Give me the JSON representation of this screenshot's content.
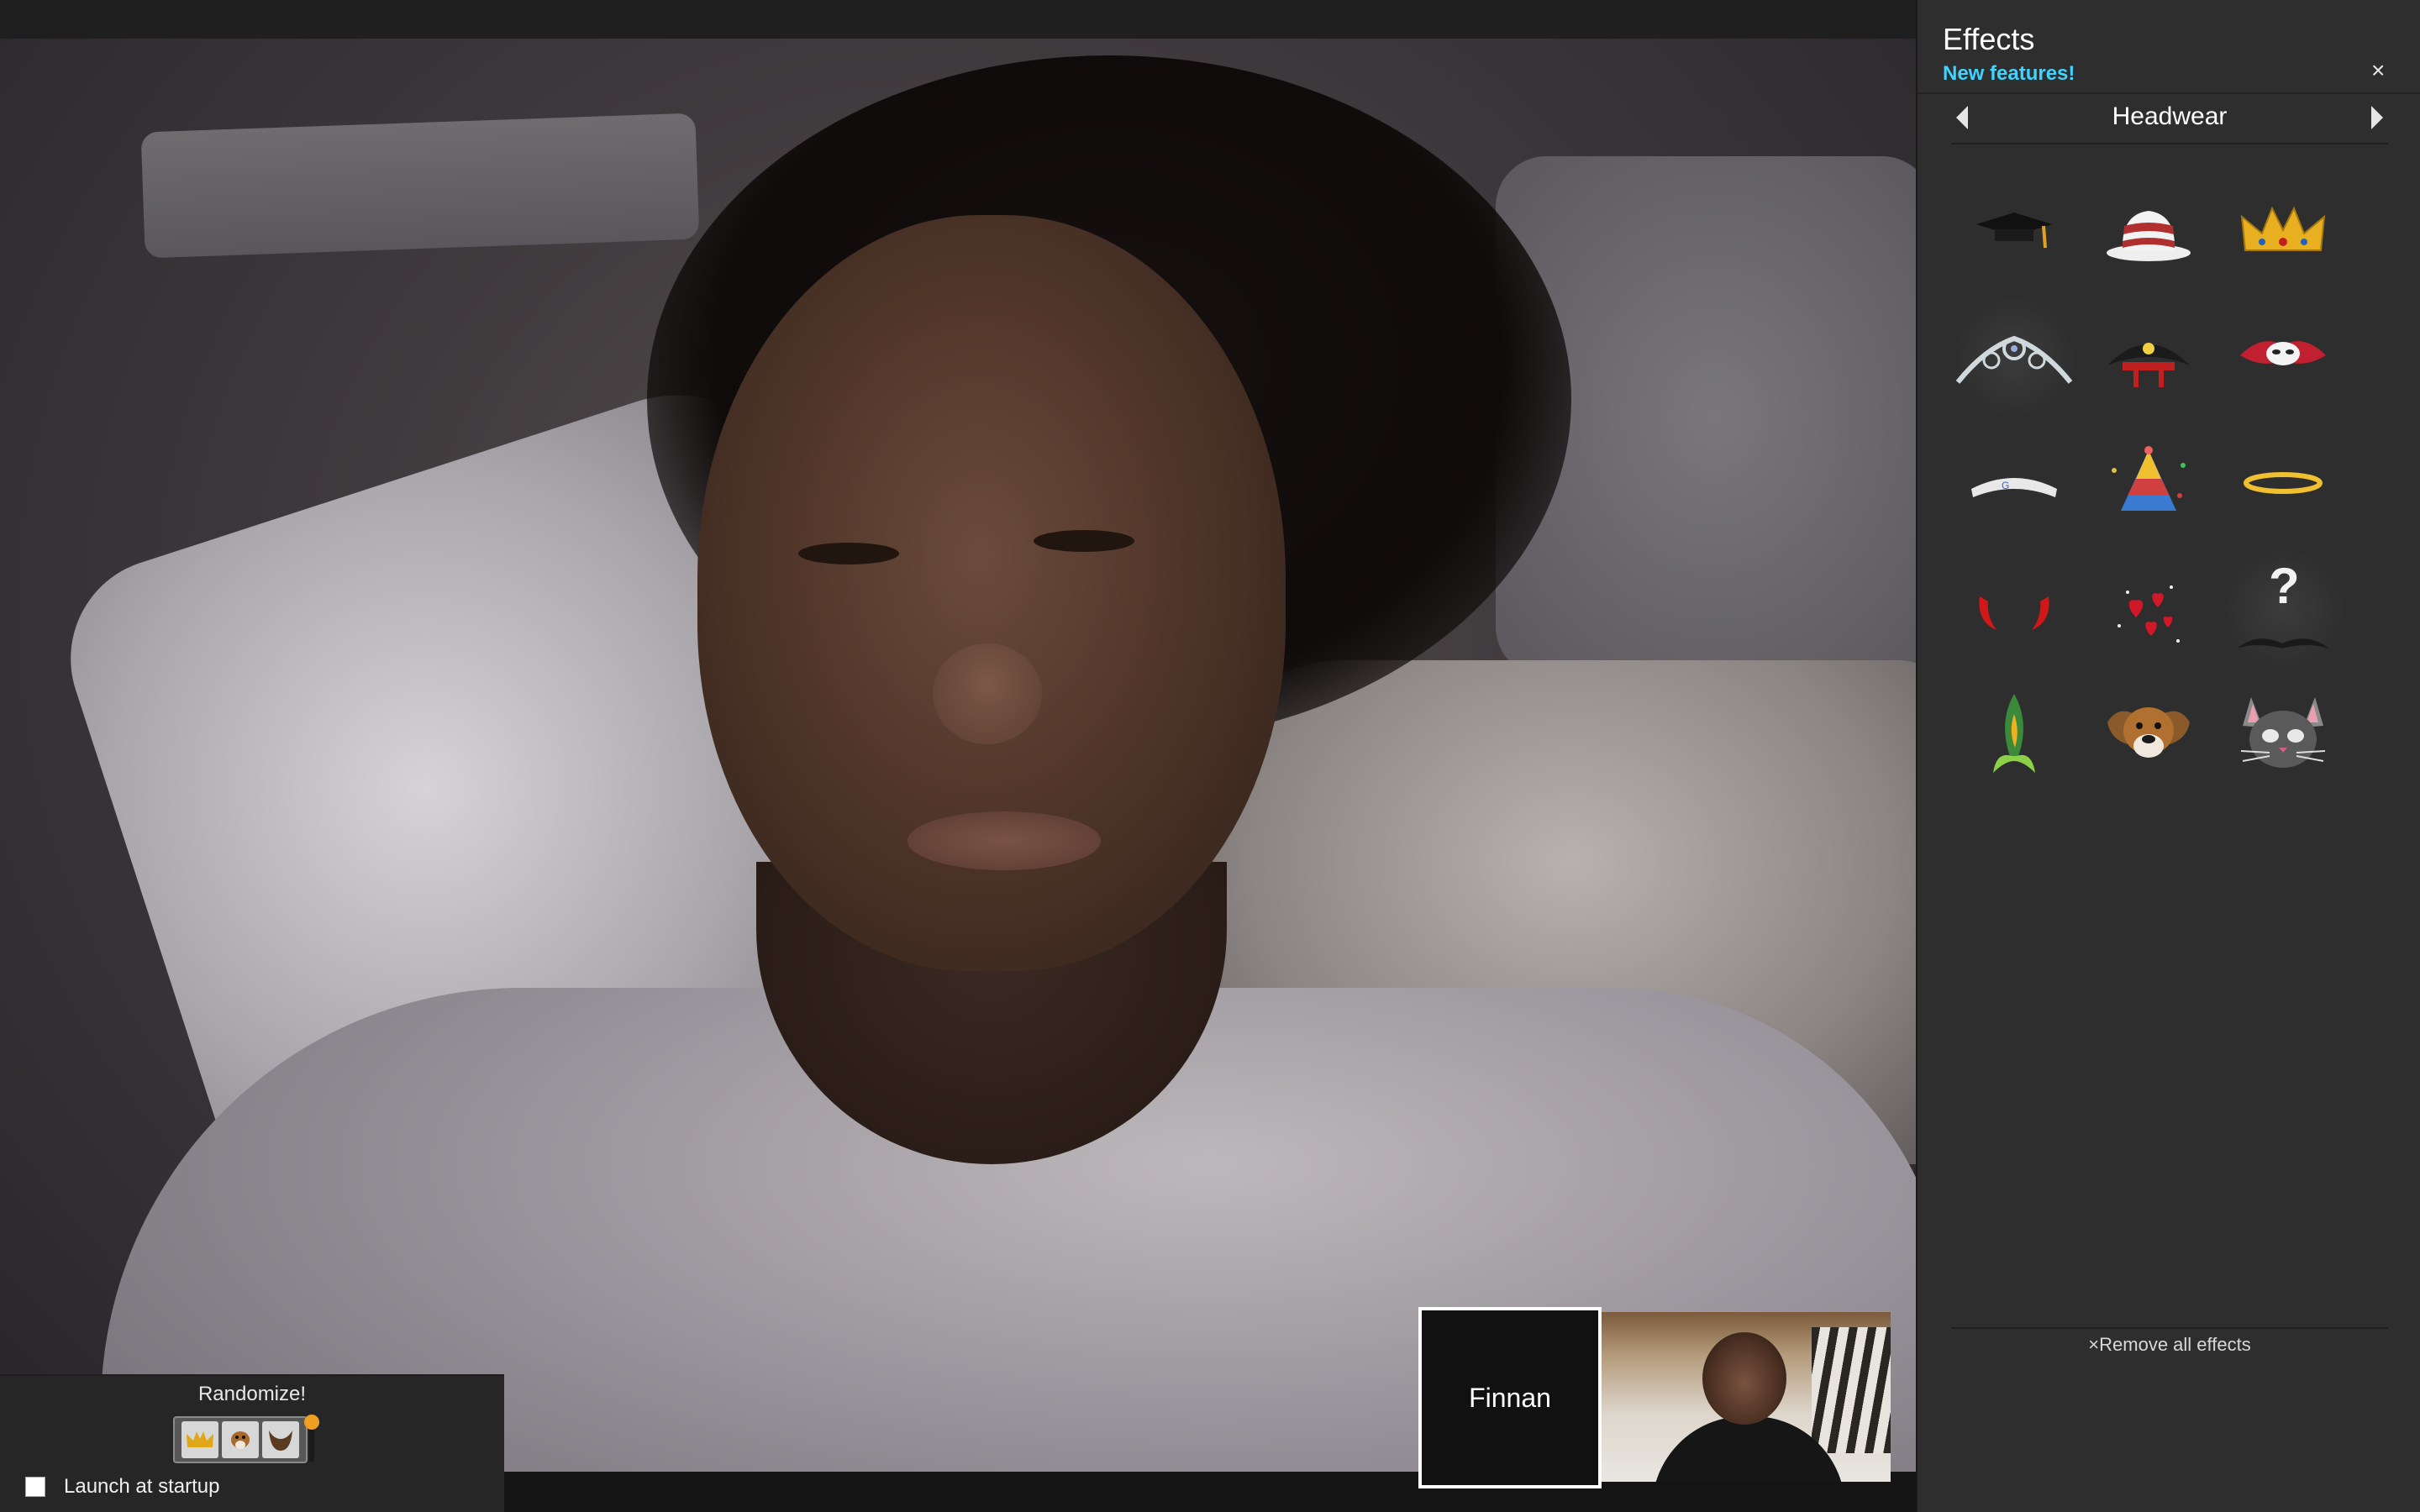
{
  "window": {
    "main_participant": "video-call"
  },
  "self_view": {
    "name": "Finnan"
  },
  "effects_panel": {
    "title": "Effects",
    "new_features": "New features!",
    "close_symbol": "×",
    "category": "Headwear",
    "effects": [
      {
        "id": "graduation-cap-icon"
      },
      {
        "id": "striped-top-hat-icon"
      },
      {
        "id": "gold-crown-icon"
      },
      {
        "id": "tiara-icon"
      },
      {
        "id": "pirate-hat-icon"
      },
      {
        "id": "red-mask-icon"
      },
      {
        "id": "google-headband-icon"
      },
      {
        "id": "party-hat-icon"
      },
      {
        "id": "halo-icon"
      },
      {
        "id": "devil-horns-icon"
      },
      {
        "id": "hearts-icon"
      },
      {
        "id": "question-mustache-icon"
      },
      {
        "id": "feather-icon"
      },
      {
        "id": "dog-face-icon"
      },
      {
        "id": "cat-face-icon"
      }
    ],
    "remove_all": "Remove all effects",
    "remove_symbol": "×",
    "randomize_label": "Randomize!",
    "launch_at_startup": "Launch at startup",
    "launch_at_startup_checked": false
  },
  "colors": {
    "accent_link": "#3fd4ff",
    "panel_bg": "#2e2e2e"
  }
}
